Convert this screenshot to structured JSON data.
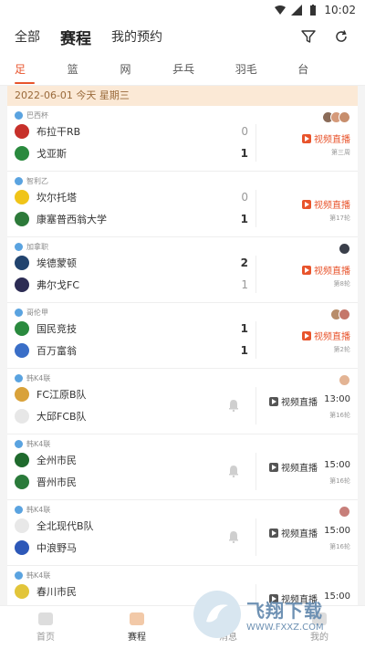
{
  "status": {
    "time": "10:02"
  },
  "topnav": {
    "tabs": [
      "全部",
      "赛程",
      "我的预约"
    ],
    "active": 1
  },
  "sports": [
    "足球",
    "篮球",
    "网球",
    "乒乓球",
    "羽毛球",
    "台球"
  ],
  "date_bar": "2022-06-01  今天  星期三",
  "matches": [
    {
      "league": "巴西杯",
      "home": "布拉干RB",
      "away": "戈亚斯",
      "home_score": "0",
      "away_score": "1",
      "home_muted": true,
      "live": "视频直播",
      "live_style": "red",
      "time": "",
      "round": "第三周",
      "avatars": [
        "#8a6b58",
        "#d59a7a",
        "#c78e6d"
      ]
    },
    {
      "league": "智利乙",
      "home": "坎尔托塔",
      "away": "康塞普西翁大学",
      "home_score": "0",
      "away_score": "1",
      "home_muted": true,
      "live": "视频直播",
      "live_style": "red",
      "time": "",
      "round": "第17轮",
      "avatars": []
    },
    {
      "league": "加拿职",
      "home": "埃德蒙顿",
      "away": "弗尔戈FC",
      "home_score": "2",
      "away_score": "1",
      "away_muted": true,
      "live": "视频直播",
      "live_style": "red",
      "time": "",
      "round": "第8轮",
      "avatars": [
        "#3a3f4a"
      ]
    },
    {
      "league": "哥伦甲",
      "home": "国民竞技",
      "away": "百万富翁",
      "home_score": "1",
      "away_score": "1",
      "live": "视频直播",
      "live_style": "red",
      "time": "",
      "round": "第2轮",
      "avatars": [
        "#b88d6a",
        "#c5776a"
      ]
    },
    {
      "league": "韩K4联",
      "home": "FC江原B队",
      "away": "大邱FCB队",
      "home_score": "",
      "away_score": "",
      "live": "视频直播",
      "live_style": "gray",
      "time": "13:00",
      "round": "第16轮",
      "avatars": [
        "#e3b494"
      ],
      "bell": true
    },
    {
      "league": "韩K4联",
      "home": "全州市民",
      "away": "晋州市民",
      "home_score": "",
      "away_score": "",
      "live": "视频直播",
      "live_style": "gray",
      "time": "15:00",
      "round": "第16轮",
      "avatars": [],
      "bell": true
    },
    {
      "league": "韩K4联",
      "home": "全北现代B队",
      "away": "中浪野马",
      "home_score": "",
      "away_score": "",
      "live": "视频直播",
      "live_style": "gray",
      "time": "15:00",
      "round": "第16轮",
      "avatars": [
        "#c77f7a"
      ],
      "bell": true
    },
    {
      "league": "韩K4联",
      "home": "春川市民",
      "away": "",
      "home_score": "",
      "away_score": "",
      "live": "视频直播",
      "live_style": "gray",
      "time": "15:00",
      "round": "",
      "avatars": []
    }
  ],
  "tabbar": {
    "items": [
      "首页",
      "赛程",
      "消息",
      "我的"
    ],
    "active": 1
  },
  "watermark": {
    "title": "飞翔下载",
    "url": "WWW.FXXZ.COM"
  },
  "colors": {
    "accent": "#e8542c",
    "date_bg": "#fbe9d6"
  }
}
